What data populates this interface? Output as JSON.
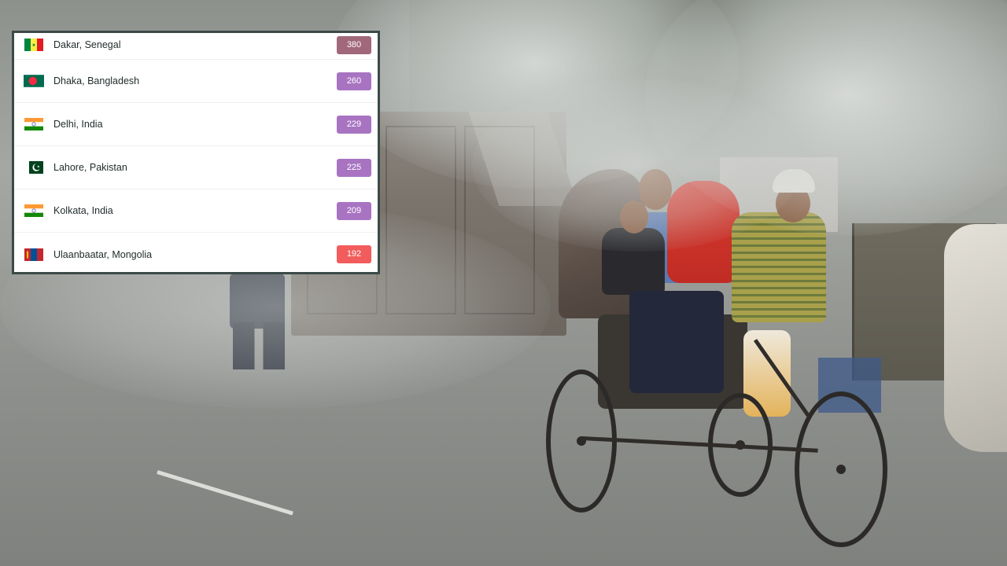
{
  "aqi_ranking": {
    "rows": [
      {
        "city": "Dakar, Senegal",
        "aqi": "380",
        "badge_color": "#a0687a",
        "flag": "senegal-flag-icon"
      },
      {
        "city": "Dhaka, Bangladesh",
        "aqi": "260",
        "badge_color": "#a874c2",
        "flag": "bangladesh-flag-icon"
      },
      {
        "city": "Delhi, India",
        "aqi": "229",
        "badge_color": "#a874c2",
        "flag": "india-flag-icon"
      },
      {
        "city": "Lahore, Pakistan",
        "aqi": "225",
        "badge_color": "#a874c2",
        "flag": "pakistan-flag-icon"
      },
      {
        "city": "Kolkata, India",
        "aqi": "209",
        "badge_color": "#a874c2",
        "flag": "india-flag-icon"
      },
      {
        "city": "Ulaanbaatar, Mongolia",
        "aqi": "192",
        "badge_color": "#f25c5c",
        "flag": "mongolia-flag-icon"
      }
    ]
  },
  "colors": {
    "card_border": "#3b4a48",
    "hazardous_badge": "#a0687a",
    "very_unhealthy_badge": "#a874c2",
    "unhealthy_badge": "#f25c5c"
  }
}
